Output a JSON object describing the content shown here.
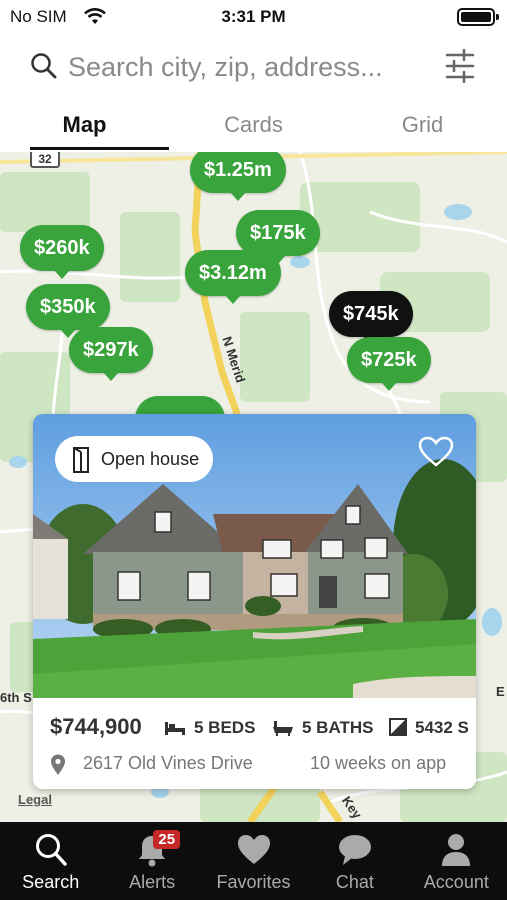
{
  "status_bar": {
    "carrier": "No SIM",
    "time": "3:31 PM"
  },
  "search": {
    "placeholder": "Search city, zip, address..."
  },
  "tabs": [
    {
      "label": "Map",
      "active": true
    },
    {
      "label": "Cards",
      "active": false
    },
    {
      "label": "Grid",
      "active": false
    }
  ],
  "map": {
    "pins": [
      {
        "label": "$1.25m",
        "selected": false
      },
      {
        "label": "$175k",
        "selected": false
      },
      {
        "label": "$260k",
        "selected": false
      },
      {
        "label": "$3.12m",
        "selected": false
      },
      {
        "label": "$350k",
        "selected": false
      },
      {
        "label": "$297k",
        "selected": false
      },
      {
        "label": "$745k",
        "selected": true
      },
      {
        "label": "$725k",
        "selected": false
      }
    ],
    "road_labels": {
      "route": "32",
      "n_meridian": "N Merid",
      "sixth": "6th S",
      "kev": "Key",
      "e": "E"
    },
    "legal": "Legal"
  },
  "listing": {
    "open_house": "Open house",
    "price": "$744,900",
    "beds": "5 BEDS",
    "baths": "5 BATHS",
    "sqft": "5432 S",
    "address": "2617 Old Vines Drive",
    "listed": "10 weeks on app"
  },
  "bottom_nav": [
    {
      "label": "Search",
      "icon": "search-icon",
      "active": true
    },
    {
      "label": "Alerts",
      "icon": "bell-icon",
      "active": false,
      "badge": "25"
    },
    {
      "label": "Favorites",
      "icon": "heart-icon",
      "active": false
    },
    {
      "label": "Chat",
      "icon": "chat-icon",
      "active": false
    },
    {
      "label": "Account",
      "icon": "account-icon",
      "active": false
    }
  ],
  "colors": {
    "pin_green": "#3aa43c",
    "pin_selected": "#111111",
    "nav_bg": "#0d0d0d",
    "alert_badge": "#c62828",
    "road_yellow": "#f2d25a"
  }
}
